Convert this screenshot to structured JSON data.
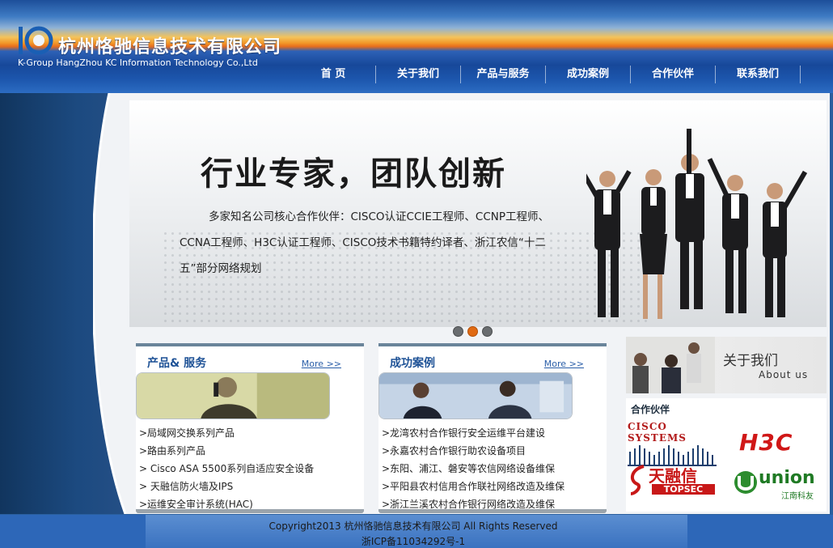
{
  "header": {
    "company_cn": "杭州恪驰信息技术有限公司",
    "company_en": "K-Group  HangZhou KC Information Technology Co.,Ltd",
    "nav": [
      "首 页",
      "关于我们",
      "产品与服务",
      "成功案例",
      "合作伙伴",
      "联系我们"
    ]
  },
  "banner": {
    "title": "行业专家，团队创新",
    "text": "多家知名公司核心合作伙伴：CISCO认证CCIE工程师、CCNP工程师、CCNA工程师、H3C认证工程师、CISCO技术书籍特约译者、浙江农信“十二五”部分网络规划",
    "active_slide": 2
  },
  "products": {
    "title": "产品& 服务",
    "more": "More >>",
    "items": [
      ">局域网交换系列产品",
      ">路由系列产品",
      "> Cisco ASA 5500系列自适应安全设备",
      "> 天融信防火墙及IPS",
      ">运维安全审计系统(HAC)"
    ]
  },
  "cases": {
    "title": "成功案例",
    "more": "More >>",
    "items": [
      ">龙湾农村合作银行安全运维平台建设",
      ">永嘉农村合作银行助农设备项目",
      ">东阳、浦江、磐安等农信网络设备维保",
      ">平阳县农村信用合作联社网络改造及维保",
      ">浙江兰溪农村合作银行网络改造及维保"
    ]
  },
  "about": {
    "cn": "关于我们",
    "en": "About us"
  },
  "partners": {
    "title": "合作伙伴",
    "cisco": "CISCO SYSTEMS",
    "h3c": "H3C",
    "topsec_cn": "天融信",
    "topsec_en": "TOPSEC",
    "union_en": "union",
    "union_cn": "江南科友"
  },
  "footer": {
    "copyright": "Copyright2013 杭州恪驰信息技术有限公司 All Rights Reserved",
    "icp": "浙ICP备11034292号-1"
  }
}
